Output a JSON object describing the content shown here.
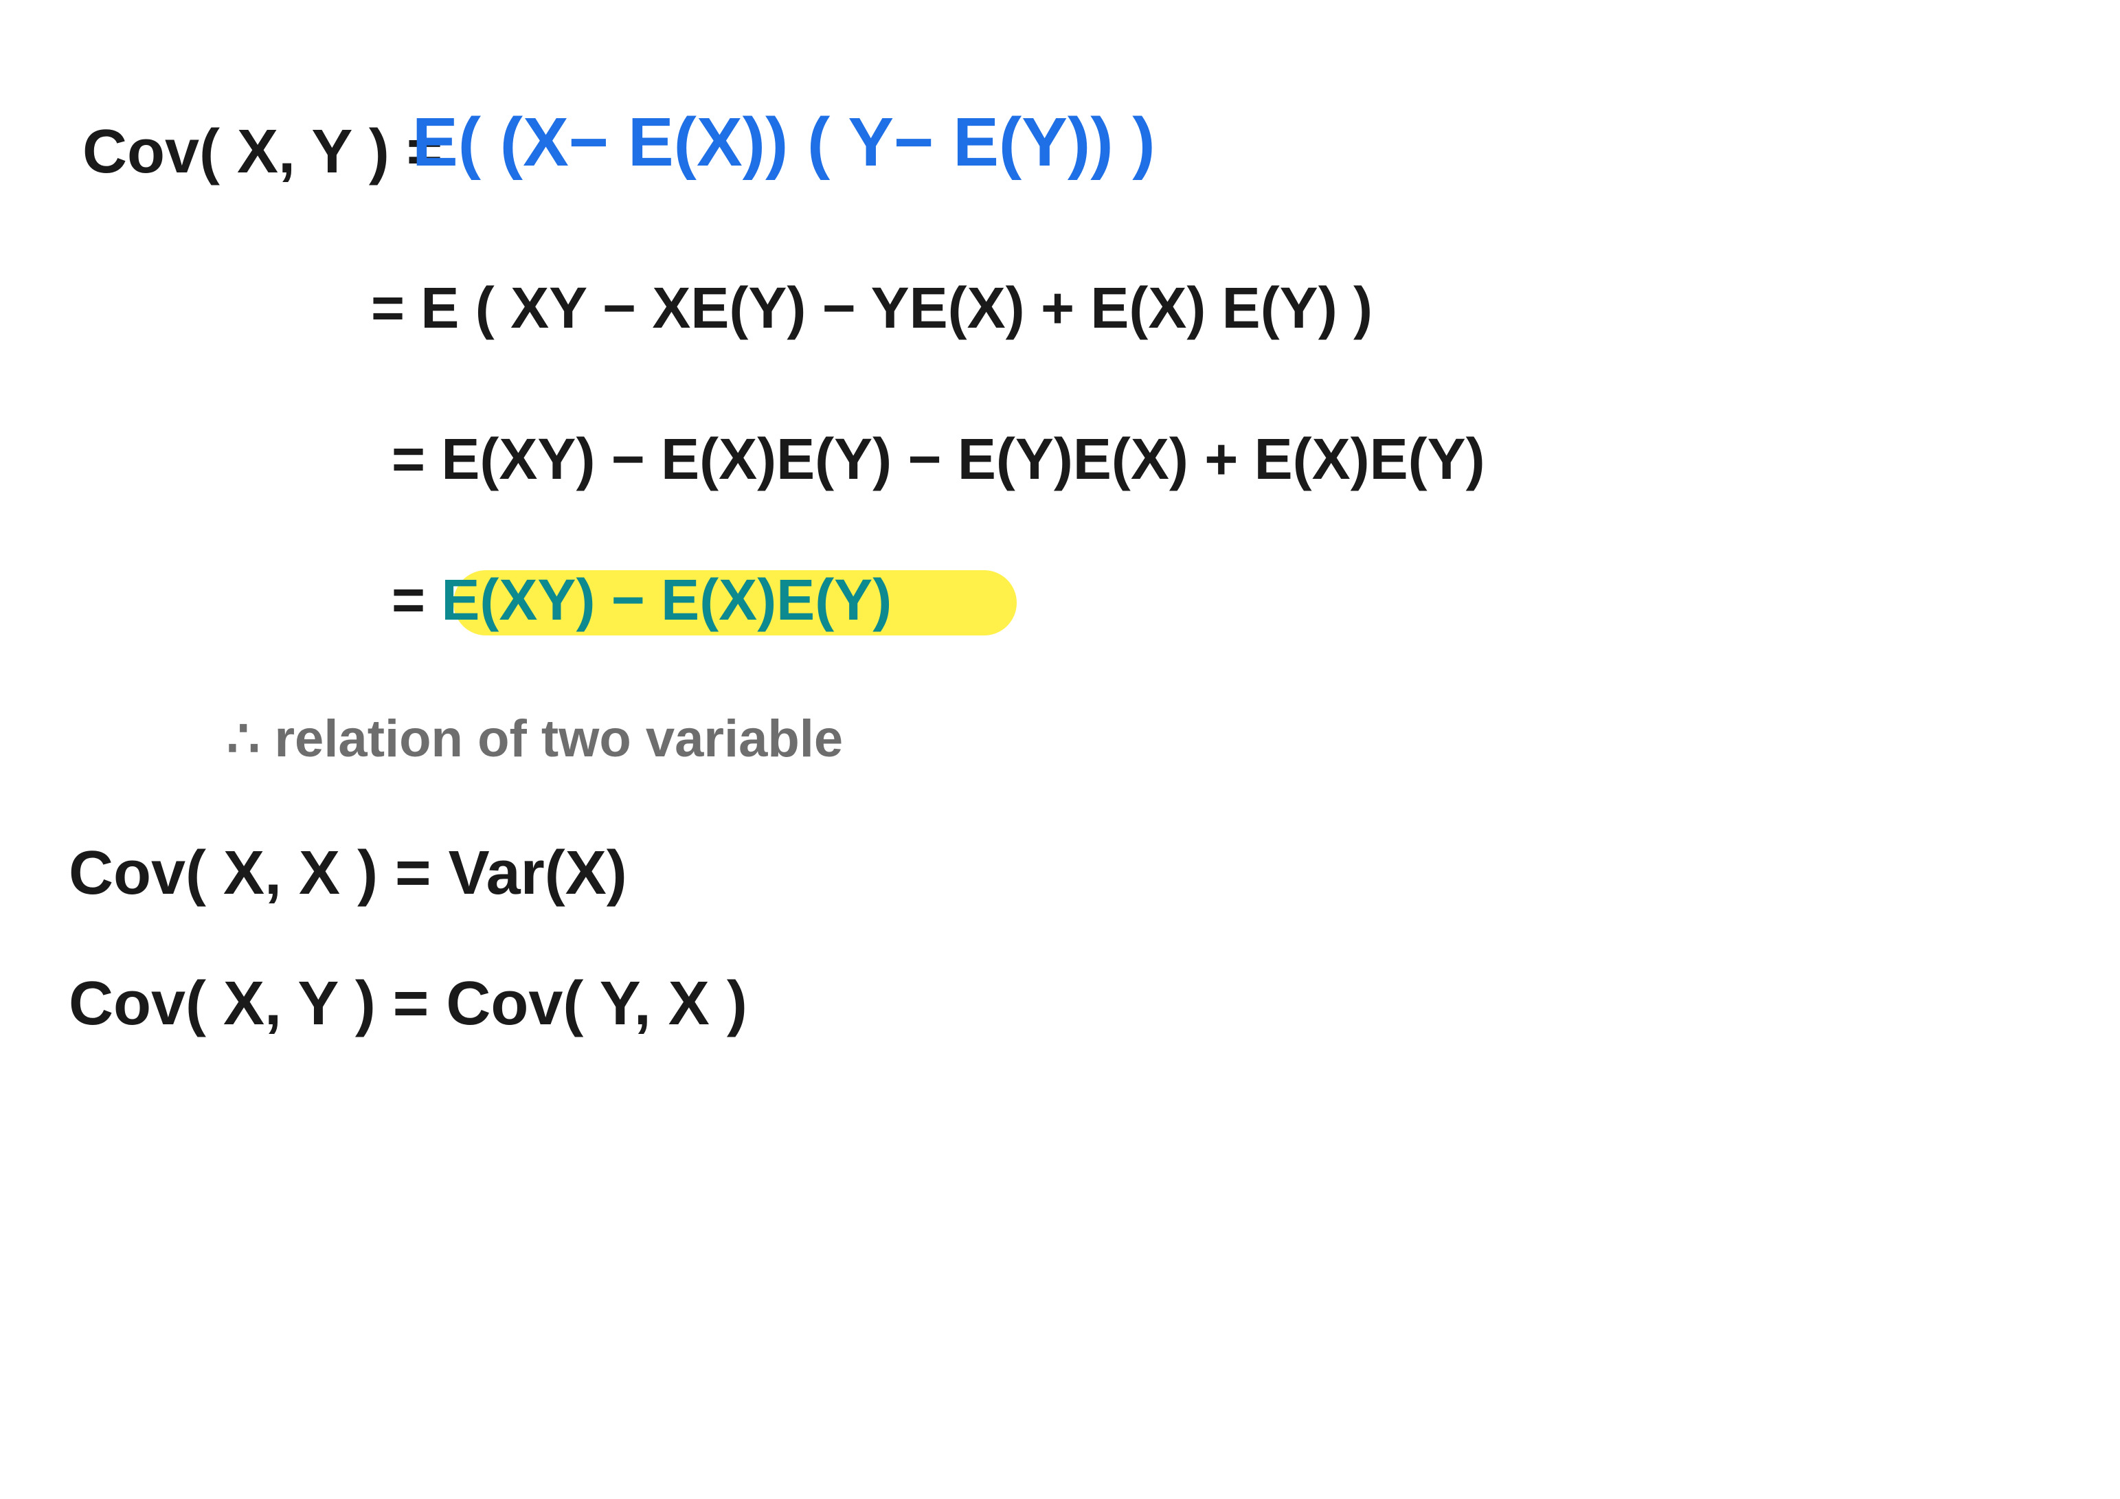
{
  "colors": {
    "black": "#1a1a1a",
    "blue": "#1f6fe6",
    "gray": "#6e6e6e",
    "teal": "#0c8a8f",
    "highlight": "#fff04a"
  },
  "lines": {
    "def_lhs": "Cov( X, Y ) =",
    "def_rhs_blue": "E( (X− E(X)) ( Y− E(Y)) )",
    "expand1": "=   E ( XY − XE(Y) − YE(X) + E(X) E(Y) )",
    "expand2": "=   E(XY) −  E(X)E(Y) − E(Y)E(X) + E(X)E(Y)",
    "result_eq": "= ",
    "result_teal": "E(XY) −  E(X)E(Y)",
    "note": "∴  relation  of  two  variable",
    "prop1": "Cov( X, X ) =  Var(X)",
    "prop2": "Cov( X, Y ) =  Cov( Y, X )"
  }
}
